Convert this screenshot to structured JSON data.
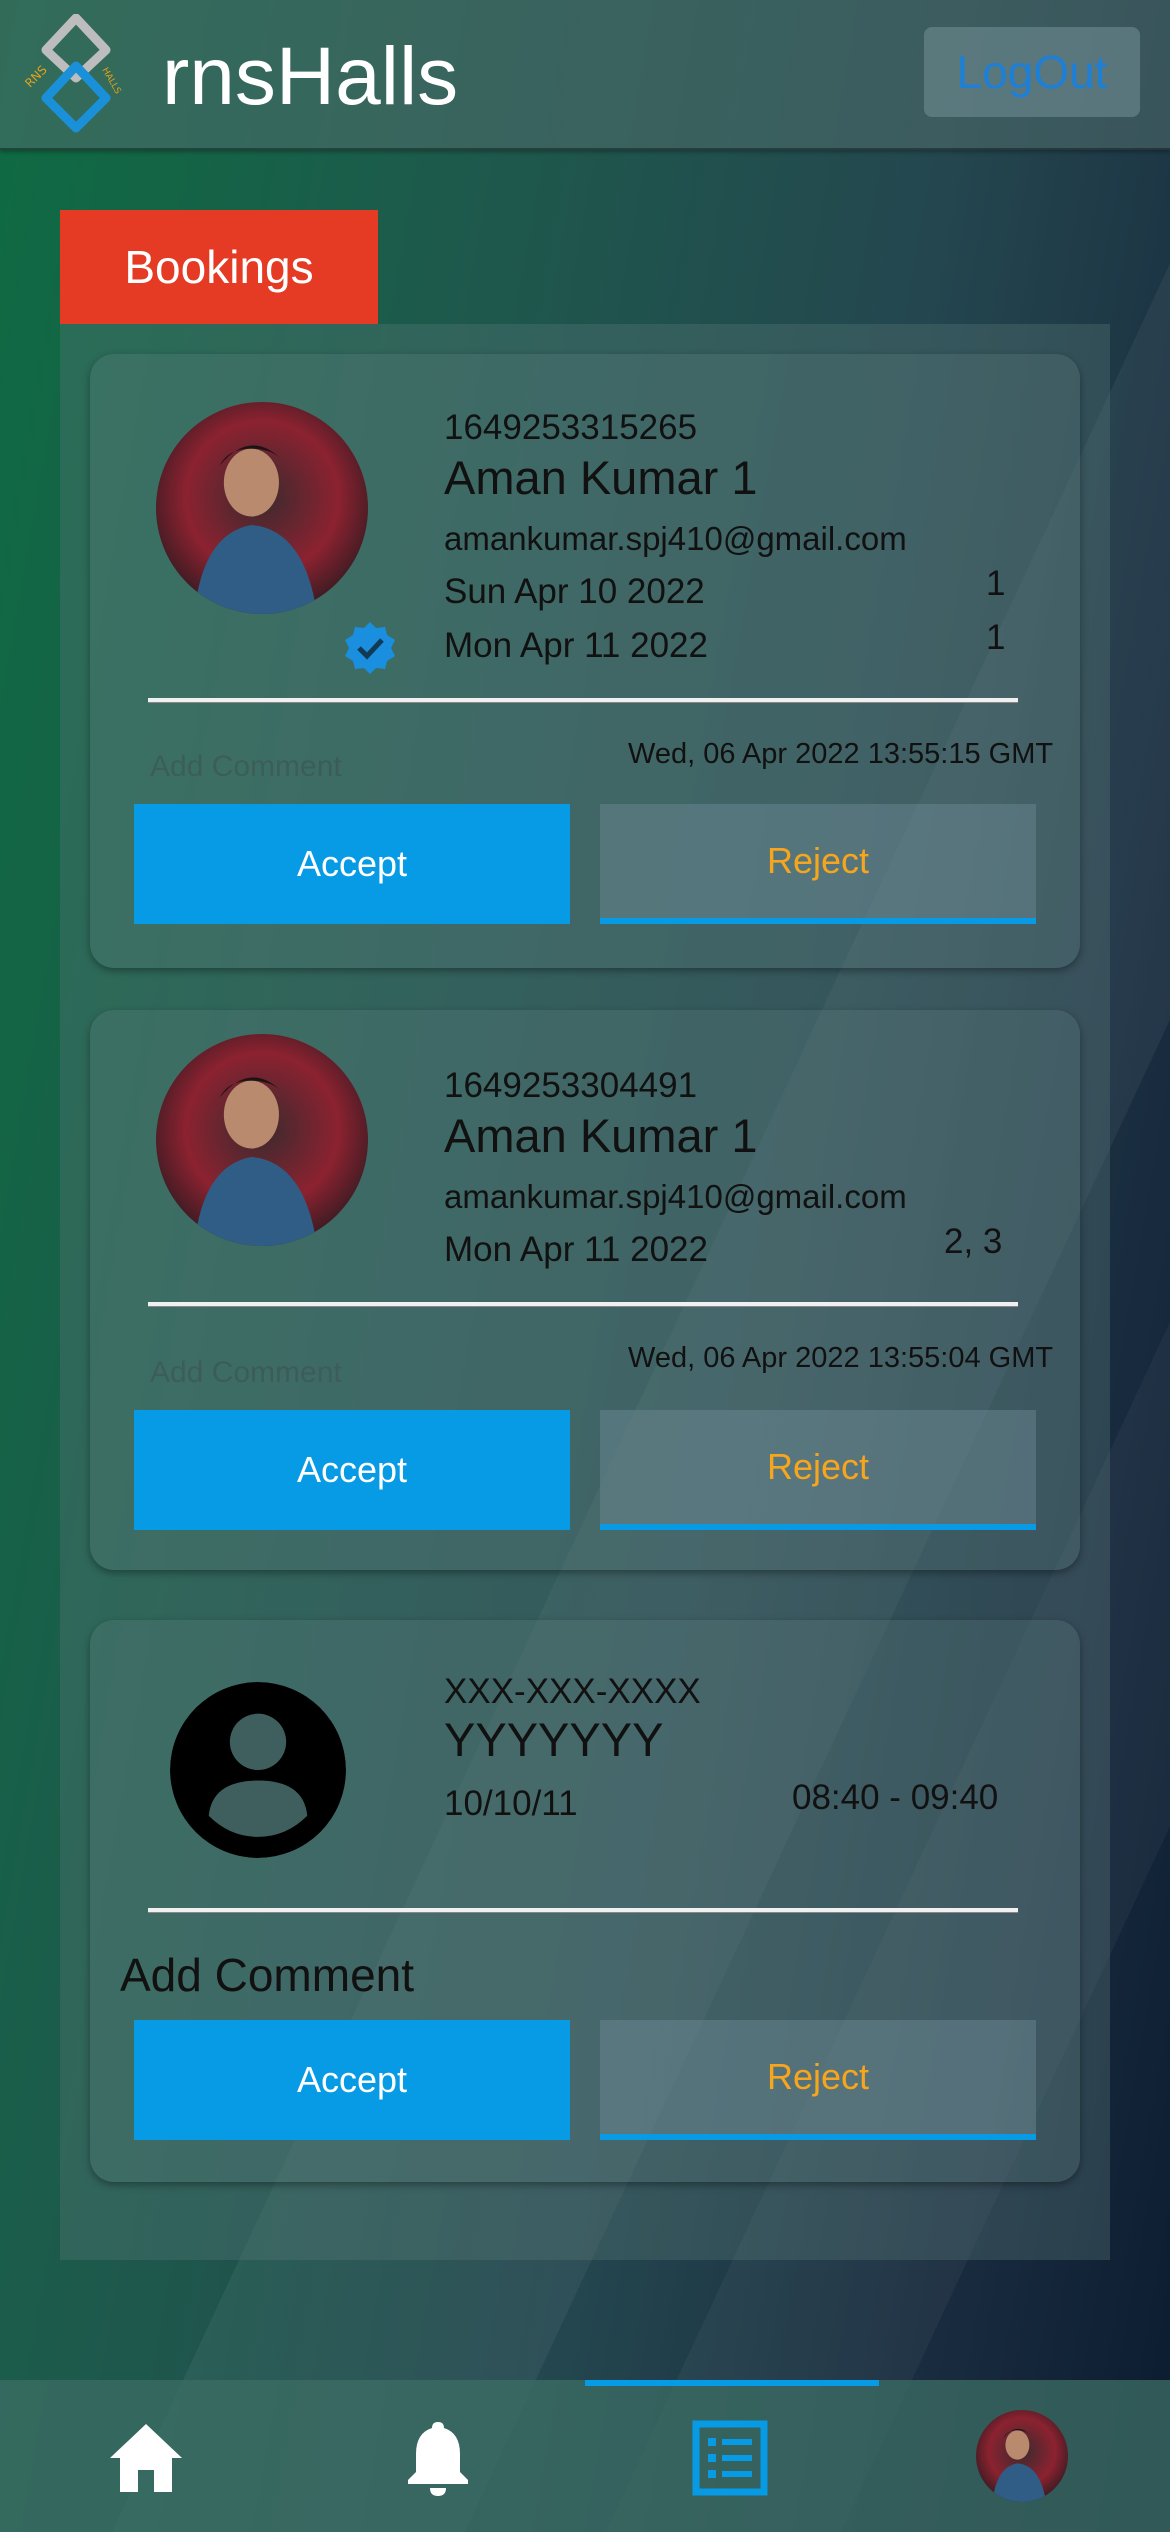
{
  "header": {
    "app_title": "rnsHalls",
    "logout_label": "LogOut",
    "logo_letters_left": "RNS",
    "logo_letters_right": "HALLS"
  },
  "bookings": {
    "tab_label": "Bookings",
    "cards": [
      {
        "id": "1649253315265",
        "name": "Aman Kumar 1",
        "email": "amankumar.spj410@gmail.com",
        "dates": [
          "Sun Apr 10 2022",
          "Mon Apr 11 2022"
        ],
        "slots": [
          "1",
          "1"
        ],
        "timestamp": "Wed, 06 Apr 2022 13:55:15 GMT",
        "comment_placeholder": "Add Comment",
        "accept_label": "Accept",
        "reject_label": "Reject",
        "verified": true
      },
      {
        "id": "1649253304491",
        "name": "Aman Kumar 1",
        "email": "amankumar.spj410@gmail.com",
        "dates": [
          "Mon Apr 11 2022"
        ],
        "slots": [
          "2, 3"
        ],
        "timestamp": "Wed, 06 Apr 2022 13:55:04 GMT",
        "comment_placeholder": "Add Comment",
        "accept_label": "Accept",
        "reject_label": "Reject",
        "verified": false
      },
      {
        "id": "XXX-XXX-XXXX",
        "name": "YYYYYYY",
        "date": "10/10/11",
        "time": "08:40 - 09:40",
        "comment_label": "Add Comment",
        "accept_label": "Accept",
        "reject_label": "Reject"
      }
    ]
  },
  "colors": {
    "accept": "#079be6",
    "reject_text": "#f7a51c",
    "bookings_tab": "#e53b24",
    "logout_text": "#1e7fd6"
  },
  "bottom_nav": {
    "items": [
      "home-icon",
      "bell-icon",
      "list-icon",
      "profile-avatar"
    ],
    "active_index": 2
  }
}
